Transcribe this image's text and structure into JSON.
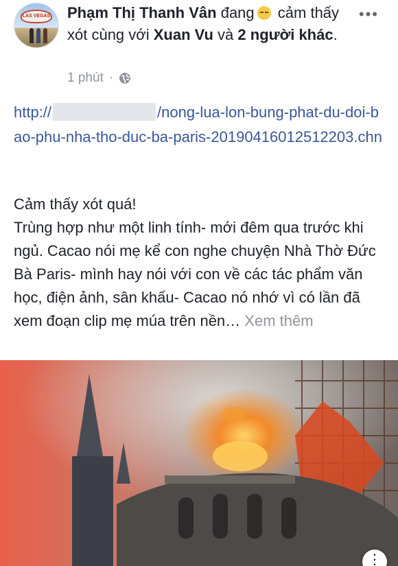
{
  "post": {
    "author": "Phạm Thị Thanh Vân",
    "feeling_prefix": "đang",
    "feeling": "cảm thấy xót cùng với",
    "tagged": "Xuan Vu",
    "connector": "và",
    "others": "2 người khác",
    "end_punct": ".",
    "time": "1 phút",
    "separator": "·",
    "more_icon": "more-horizontal-icon",
    "privacy_icon": "globe-icon"
  },
  "link": {
    "prefix": "http://",
    "suffix": "/nong-lua-lon-bung-phat-du-doi-bao-phu-nha-tho-duc-ba-paris-20190416012512203.chn"
  },
  "body": {
    "line1": "Cảm thấy xót quá!",
    "text": "Trùng hợp như một linh tính- mới đêm qua trước khi ngủ. Cacao nói mẹ kể con nghe chuyện Nhà Thờ Đức Bà Paris- mình hay nói với con về các tác phẩm văn học, điện ảnh, sân khấu- Cacao nó nhớ vì có lần đã xem đoạn clip mẹ múa trên nền…",
    "see_more": "Xem thêm"
  },
  "avatar": {
    "sign_text": "LAS VEGAS"
  },
  "colors": {
    "link": "#385898",
    "meta": "#90949c",
    "text": "#1d2129"
  }
}
